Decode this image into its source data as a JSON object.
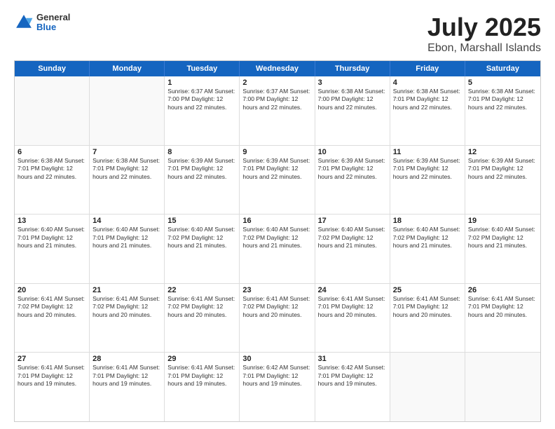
{
  "header": {
    "logo_general": "General",
    "logo_blue": "Blue",
    "title": "July 2025",
    "subtitle": "Ebon, Marshall Islands"
  },
  "weekdays": [
    "Sunday",
    "Monday",
    "Tuesday",
    "Wednesday",
    "Thursday",
    "Friday",
    "Saturday"
  ],
  "weeks": [
    [
      {
        "day": "",
        "info": ""
      },
      {
        "day": "",
        "info": ""
      },
      {
        "day": "1",
        "info": "Sunrise: 6:37 AM\nSunset: 7:00 PM\nDaylight: 12 hours and 22 minutes."
      },
      {
        "day": "2",
        "info": "Sunrise: 6:37 AM\nSunset: 7:00 PM\nDaylight: 12 hours and 22 minutes."
      },
      {
        "day": "3",
        "info": "Sunrise: 6:38 AM\nSunset: 7:00 PM\nDaylight: 12 hours and 22 minutes."
      },
      {
        "day": "4",
        "info": "Sunrise: 6:38 AM\nSunset: 7:01 PM\nDaylight: 12 hours and 22 minutes."
      },
      {
        "day": "5",
        "info": "Sunrise: 6:38 AM\nSunset: 7:01 PM\nDaylight: 12 hours and 22 minutes."
      }
    ],
    [
      {
        "day": "6",
        "info": "Sunrise: 6:38 AM\nSunset: 7:01 PM\nDaylight: 12 hours and 22 minutes."
      },
      {
        "day": "7",
        "info": "Sunrise: 6:38 AM\nSunset: 7:01 PM\nDaylight: 12 hours and 22 minutes."
      },
      {
        "day": "8",
        "info": "Sunrise: 6:39 AM\nSunset: 7:01 PM\nDaylight: 12 hours and 22 minutes."
      },
      {
        "day": "9",
        "info": "Sunrise: 6:39 AM\nSunset: 7:01 PM\nDaylight: 12 hours and 22 minutes."
      },
      {
        "day": "10",
        "info": "Sunrise: 6:39 AM\nSunset: 7:01 PM\nDaylight: 12 hours and 22 minutes."
      },
      {
        "day": "11",
        "info": "Sunrise: 6:39 AM\nSunset: 7:01 PM\nDaylight: 12 hours and 22 minutes."
      },
      {
        "day": "12",
        "info": "Sunrise: 6:39 AM\nSunset: 7:01 PM\nDaylight: 12 hours and 22 minutes."
      }
    ],
    [
      {
        "day": "13",
        "info": "Sunrise: 6:40 AM\nSunset: 7:01 PM\nDaylight: 12 hours and 21 minutes."
      },
      {
        "day": "14",
        "info": "Sunrise: 6:40 AM\nSunset: 7:01 PM\nDaylight: 12 hours and 21 minutes."
      },
      {
        "day": "15",
        "info": "Sunrise: 6:40 AM\nSunset: 7:02 PM\nDaylight: 12 hours and 21 minutes."
      },
      {
        "day": "16",
        "info": "Sunrise: 6:40 AM\nSunset: 7:02 PM\nDaylight: 12 hours and 21 minutes."
      },
      {
        "day": "17",
        "info": "Sunrise: 6:40 AM\nSunset: 7:02 PM\nDaylight: 12 hours and 21 minutes."
      },
      {
        "day": "18",
        "info": "Sunrise: 6:40 AM\nSunset: 7:02 PM\nDaylight: 12 hours and 21 minutes."
      },
      {
        "day": "19",
        "info": "Sunrise: 6:40 AM\nSunset: 7:02 PM\nDaylight: 12 hours and 21 minutes."
      }
    ],
    [
      {
        "day": "20",
        "info": "Sunrise: 6:41 AM\nSunset: 7:02 PM\nDaylight: 12 hours and 20 minutes."
      },
      {
        "day": "21",
        "info": "Sunrise: 6:41 AM\nSunset: 7:02 PM\nDaylight: 12 hours and 20 minutes."
      },
      {
        "day": "22",
        "info": "Sunrise: 6:41 AM\nSunset: 7:02 PM\nDaylight: 12 hours and 20 minutes."
      },
      {
        "day": "23",
        "info": "Sunrise: 6:41 AM\nSunset: 7:02 PM\nDaylight: 12 hours and 20 minutes."
      },
      {
        "day": "24",
        "info": "Sunrise: 6:41 AM\nSunset: 7:01 PM\nDaylight: 12 hours and 20 minutes."
      },
      {
        "day": "25",
        "info": "Sunrise: 6:41 AM\nSunset: 7:01 PM\nDaylight: 12 hours and 20 minutes."
      },
      {
        "day": "26",
        "info": "Sunrise: 6:41 AM\nSunset: 7:01 PM\nDaylight: 12 hours and 20 minutes."
      }
    ],
    [
      {
        "day": "27",
        "info": "Sunrise: 6:41 AM\nSunset: 7:01 PM\nDaylight: 12 hours and 19 minutes."
      },
      {
        "day": "28",
        "info": "Sunrise: 6:41 AM\nSunset: 7:01 PM\nDaylight: 12 hours and 19 minutes."
      },
      {
        "day": "29",
        "info": "Sunrise: 6:41 AM\nSunset: 7:01 PM\nDaylight: 12 hours and 19 minutes."
      },
      {
        "day": "30",
        "info": "Sunrise: 6:42 AM\nSunset: 7:01 PM\nDaylight: 12 hours and 19 minutes."
      },
      {
        "day": "31",
        "info": "Sunrise: 6:42 AM\nSunset: 7:01 PM\nDaylight: 12 hours and 19 minutes."
      },
      {
        "day": "",
        "info": ""
      },
      {
        "day": "",
        "info": ""
      }
    ]
  ]
}
